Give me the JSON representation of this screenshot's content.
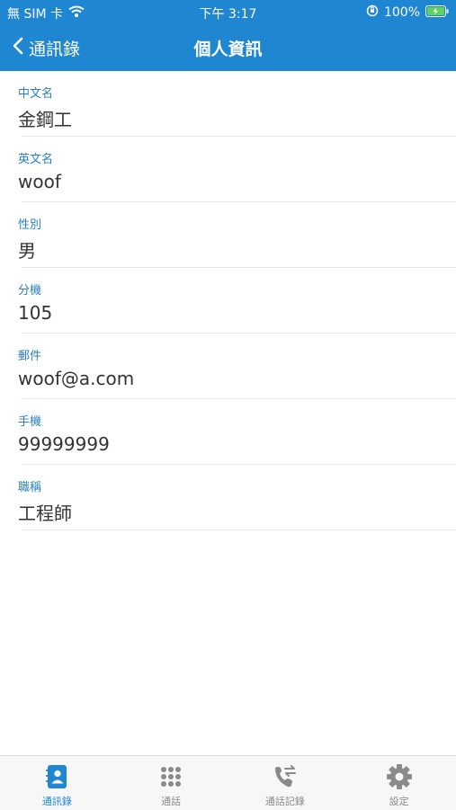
{
  "status_bar": {
    "carrier": "無 SIM 卡",
    "time": "下午 3:17",
    "battery": "100%"
  },
  "nav": {
    "back_label": "通訊錄",
    "title": "個人資訊"
  },
  "fields": [
    {
      "label": "中文名",
      "value": "金鋼工"
    },
    {
      "label": "英文名",
      "value": "woof"
    },
    {
      "label": "性別",
      "value": "男"
    },
    {
      "label": "分機",
      "value": "105"
    },
    {
      "label": "郵件",
      "value": "woof@a.com"
    },
    {
      "label": "手機",
      "value": "99999999"
    },
    {
      "label": "職稱",
      "value": "工程師"
    }
  ],
  "tabs": [
    {
      "label": "通訊錄",
      "icon": "contacts-icon",
      "active": true
    },
    {
      "label": "通話",
      "icon": "keypad-icon",
      "active": false
    },
    {
      "label": "通話記錄",
      "icon": "call-log-icon",
      "active": false
    },
    {
      "label": "設定",
      "icon": "gear-icon",
      "active": false
    }
  ],
  "colors": {
    "header": "#1f86d2",
    "label": "#2a7fc0",
    "tab_active": "#1f86d2",
    "tab_inactive": "#8a8a8a"
  }
}
